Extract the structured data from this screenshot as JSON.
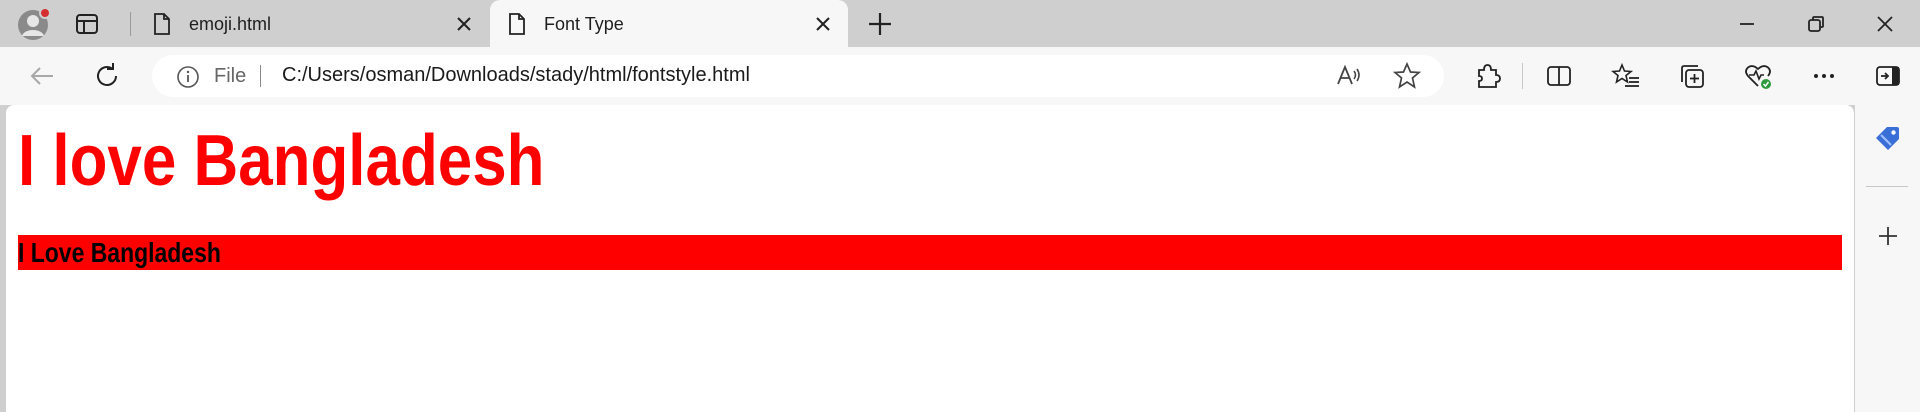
{
  "browser": {
    "tabs": [
      {
        "title": "emoji.html",
        "active": false
      },
      {
        "title": "Font Type",
        "active": true
      }
    ],
    "address_bar": {
      "scheme_label": "File",
      "url": "C:/Users/osman/Downloads/stady/html/fontstyle.html"
    },
    "colors": {
      "tab_strip": "#cfcfcf",
      "toolbar": "#f7f7f7",
      "profile_badge": "#d32f2f",
      "sidebar_accent": "#3b6fd8"
    }
  },
  "page": {
    "heading_large": "I love Bangladesh",
    "heading_banner": "I Love Bangladesh",
    "colors": {
      "heading_text": "#ff0000",
      "banner_background": "#ff0000",
      "banner_text": "#000000"
    }
  }
}
